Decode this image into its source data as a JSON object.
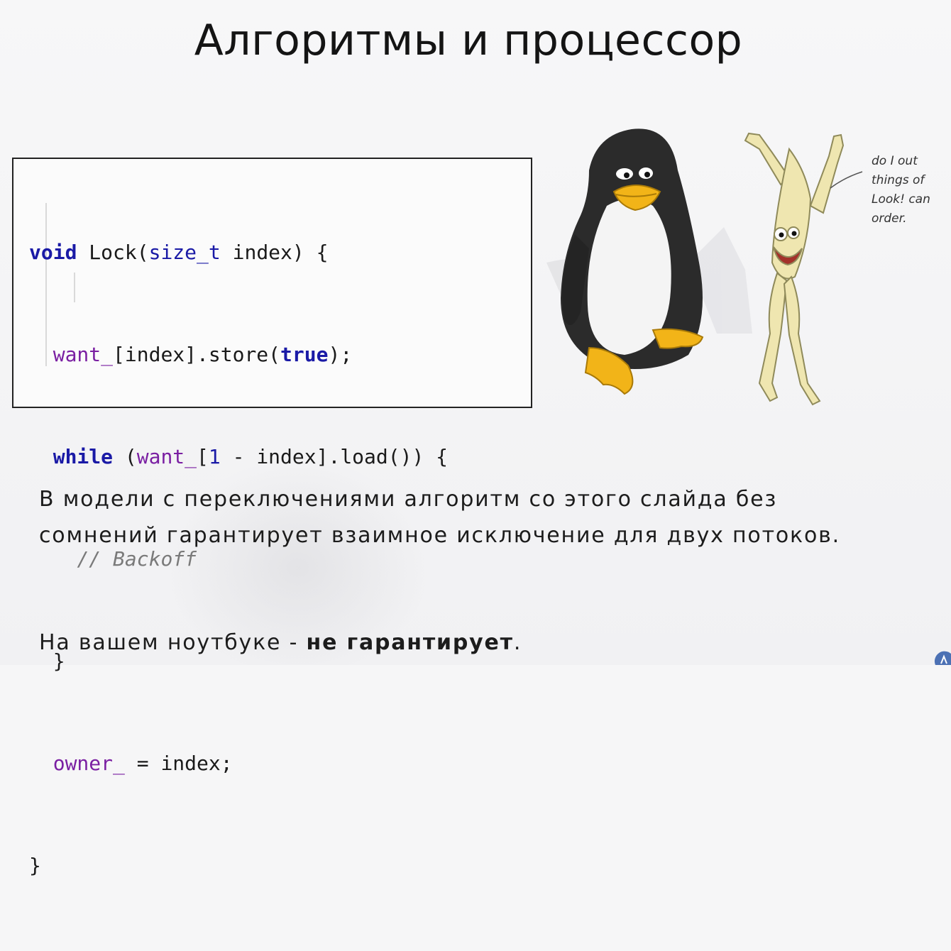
{
  "slide": {
    "title": "Алгоритмы и процессор",
    "code": {
      "line1": {
        "kw": "void",
        "text": " Lock(",
        "type": "size_t",
        "rest": " index) {"
      },
      "line2": {
        "member": "want_",
        "text": "[index].store(",
        "bool": "true",
        "rest": ");"
      },
      "line3": {
        "kw": "while",
        "text": " (",
        "member": "want_",
        "text2": "[",
        "num": "1",
        "rest": " - index].load()) {"
      },
      "line4": {
        "comment": "// Backoff"
      },
      "line5": {
        "text": "}"
      },
      "line6": {
        "member": "owner_",
        "rest": " = index;"
      },
      "line7": {
        "text": "}"
      }
    },
    "cartoon_note": [
      "do I out",
      "things of",
      "Look! can",
      "order."
    ],
    "paragraph": "В модели с переключениями алгоритм со этого слайда без сомнений гарантирует взаимное исключение для двух потоков.",
    "conclusion_prefix": "На вашем ноутбуке - ",
    "conclusion_bold": "не гарантирует",
    "conclusion_suffix": "."
  },
  "colors": {
    "keyword": "#1a1aa6",
    "member": "#7a1fa2",
    "comment": "#7a7a7a",
    "penguin_body": "#2b2b2b",
    "penguin_beak": "#f2b418",
    "lambda_figure": "#efe6b0"
  },
  "icons": [
    "penguin-illustration",
    "lambda-character-illustration",
    "watermark-logo-icon"
  ]
}
